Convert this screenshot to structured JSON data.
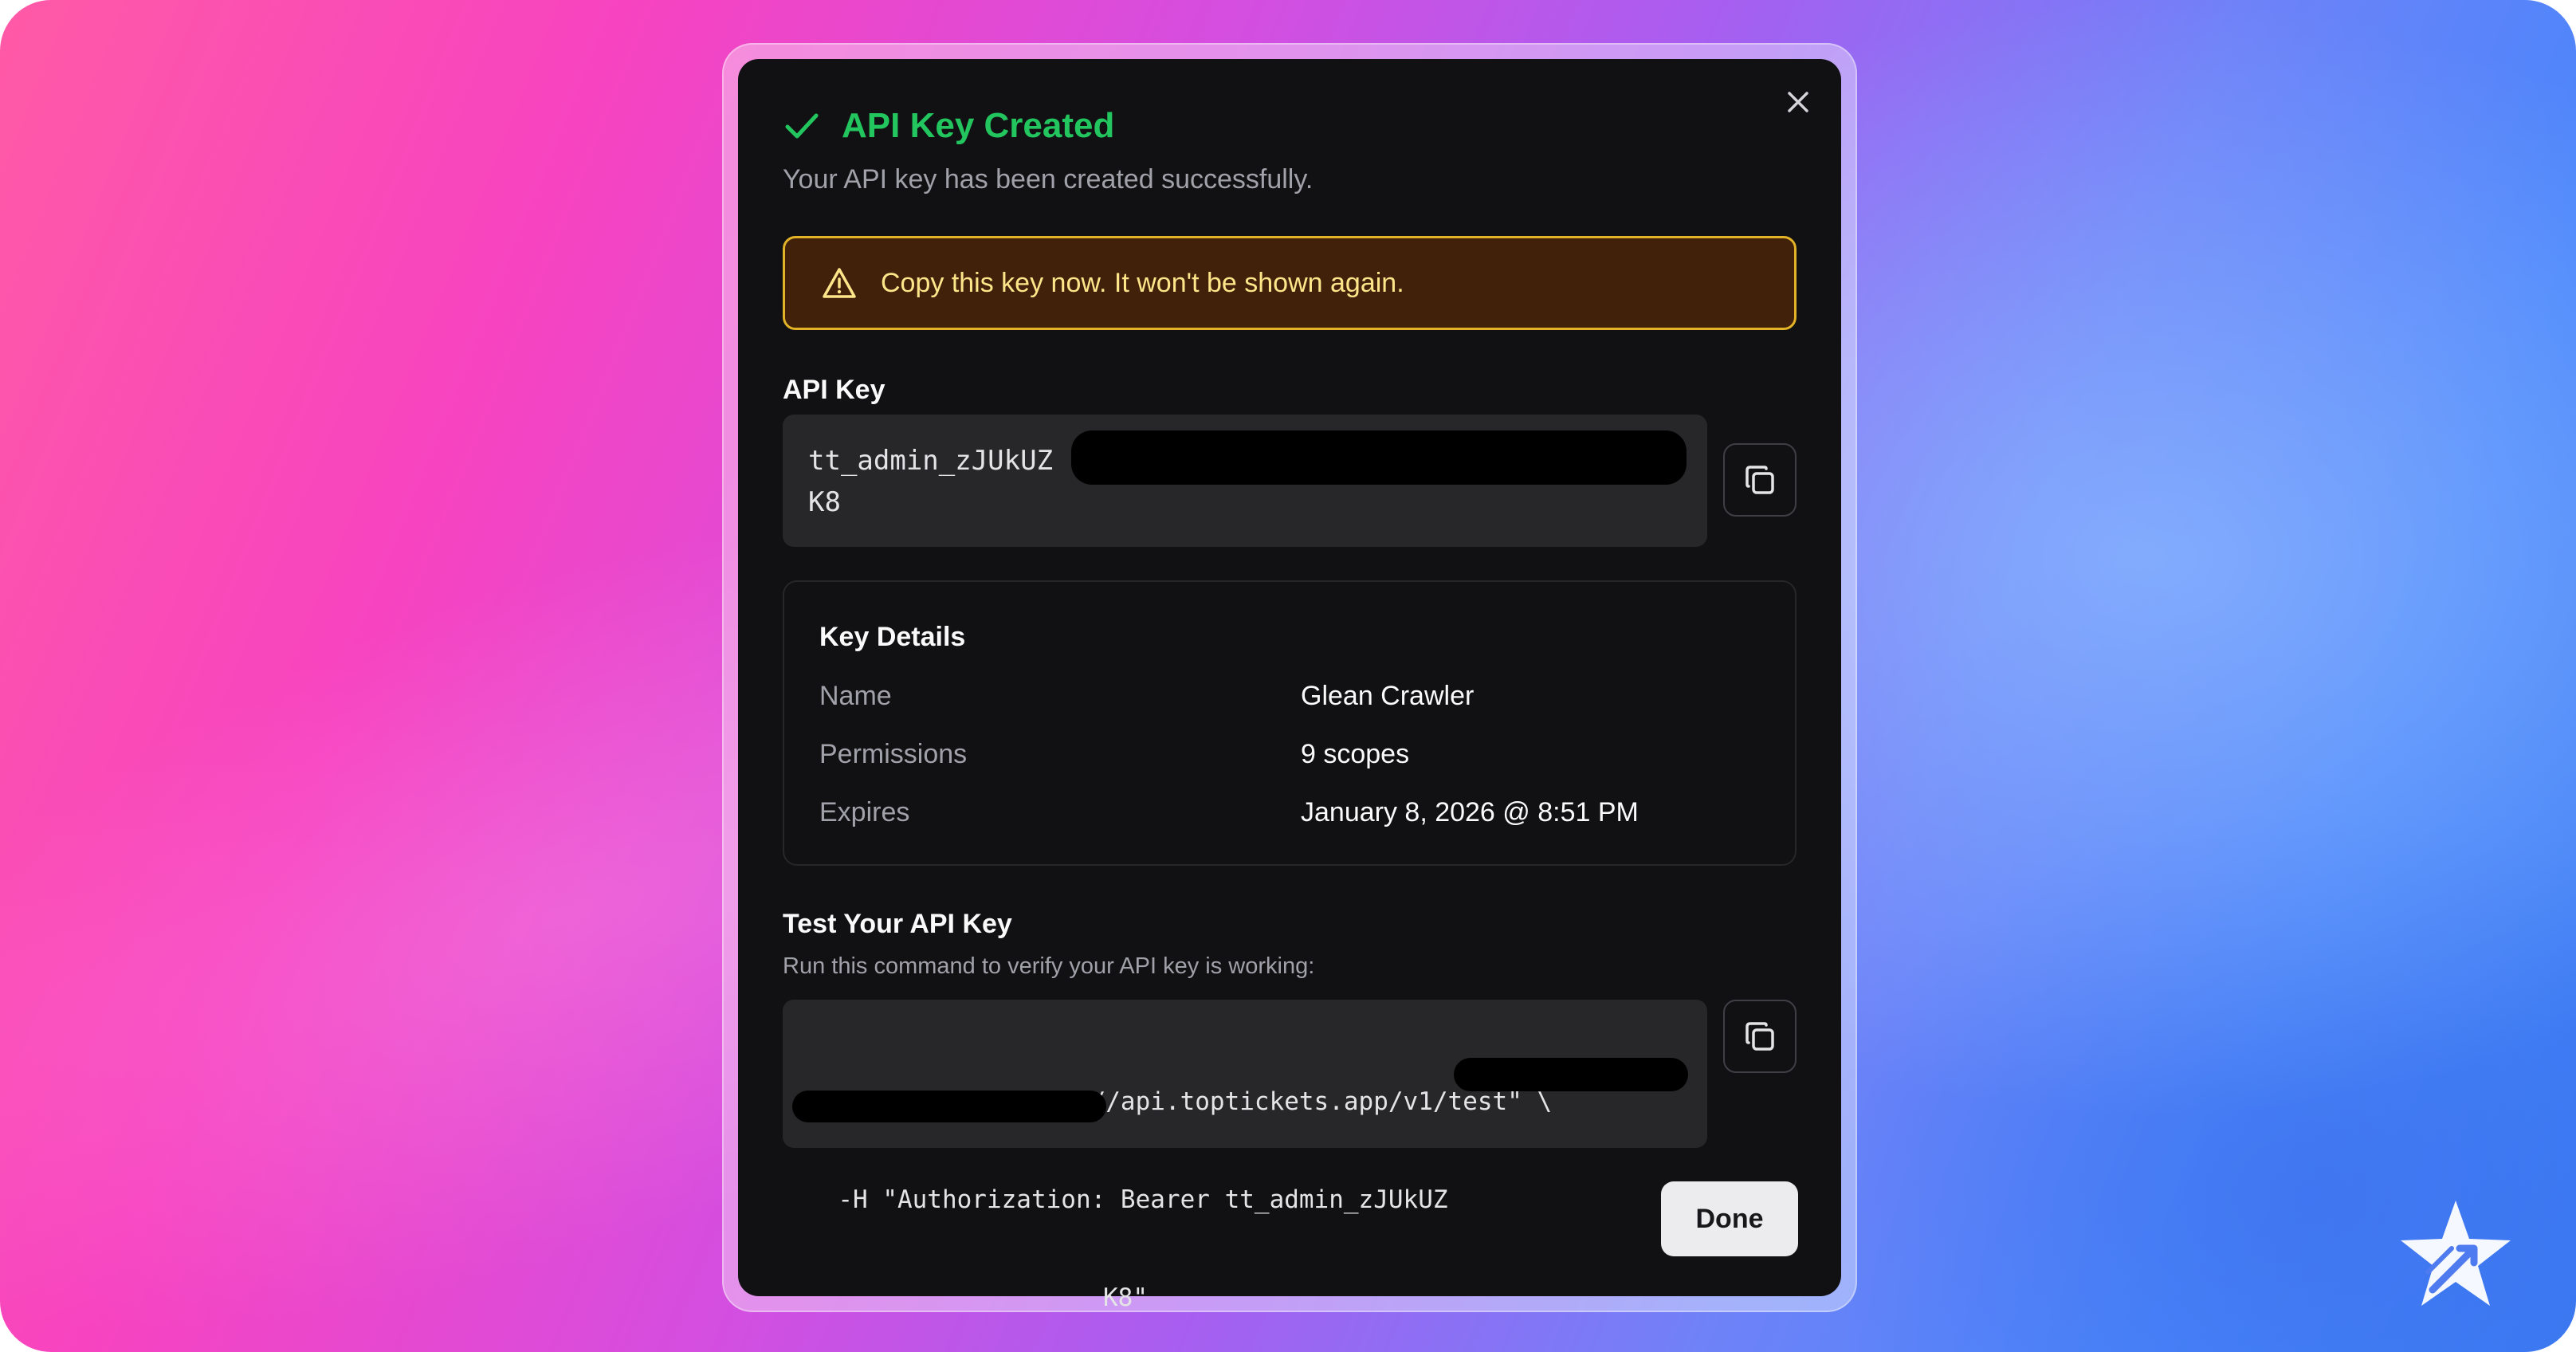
{
  "dialog": {
    "title": "API Key Created",
    "subtitle": "Your API key has been created successfully.",
    "warning": "Copy this key now. It won't be shown again.",
    "api_key": {
      "label": "API Key",
      "value_line1": "tt_admin_zJUkUZ",
      "value_line2": "K8"
    },
    "key_details": {
      "title": "Key Details",
      "rows": [
        {
          "key": "Name",
          "value": "Glean Crawler"
        },
        {
          "key": "Permissions",
          "value": "9 scopes"
        },
        {
          "key": "Expires",
          "value": "January 8, 2026 @ 8:51 PM"
        }
      ]
    },
    "test": {
      "title": "Test Your API Key",
      "hint": "Run this command to verify your API key is working:",
      "command_line1": "curl -X GET \"https://api.toptickets.app/v1/test\" \\",
      "command_line2": "  -H \"Authorization: Bearer tt_admin_zJUkUZ",
      "command_line3": "K8\""
    },
    "done_label": "Done"
  },
  "icons": {
    "title_icon": "check-icon",
    "close": "close-icon",
    "warning": "warning-triangle-icon",
    "copy": "copy-icon",
    "brand_logo": "star-logo-icon"
  },
  "colors": {
    "success": "#22c55e",
    "warning_border": "#e2b227",
    "warning_bg": "#42210b",
    "warning_text": "#fde68a",
    "dialog_bg": "#111113"
  }
}
